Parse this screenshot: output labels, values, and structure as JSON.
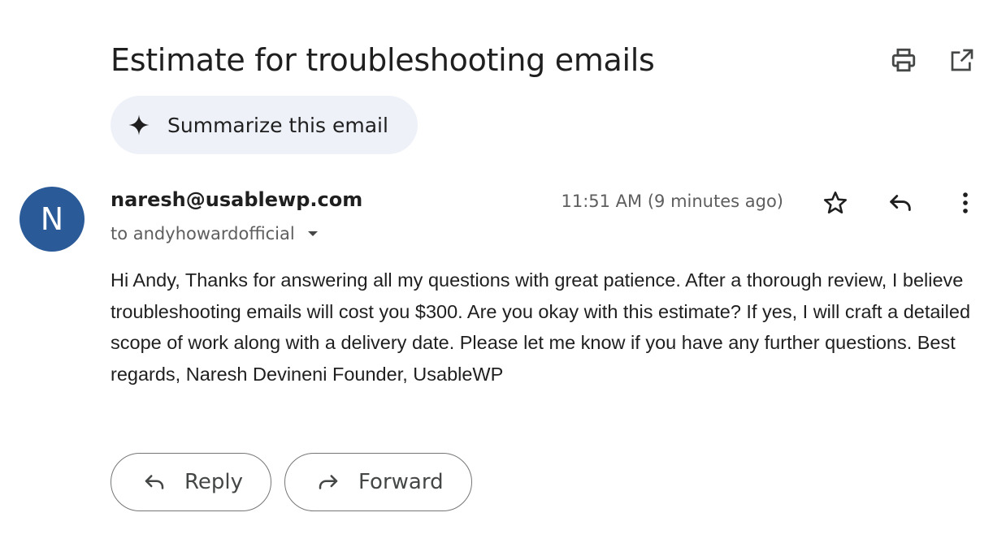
{
  "email": {
    "subject": "Estimate for troubleshooting emails",
    "summarize_label": "Summarize this email",
    "avatar_initial": "N",
    "sender": "naresh@usablewp.com",
    "recipients": "to andyhowardofficial",
    "timestamp": "11:51 AM (9 minutes ago)",
    "body": "Hi Andy, Thanks for answering all my questions with great patience. After a thorough review, I believe troubleshooting emails will cost you $300. Are you okay with this estimate? If yes, I will craft a detailed scope of work along with a delivery date. Please let me know if you have any further questions. Best regards, Naresh Devineni Founder, UsableWP"
  },
  "actions": {
    "reply_label": "Reply",
    "forward_label": "Forward"
  },
  "icons": {
    "top": [
      "print-icon",
      "open-in-new-window-icon"
    ],
    "message": [
      "star-icon",
      "reply-icon",
      "more-vert-icon"
    ]
  },
  "colors": {
    "avatar_bg": "#2a5a97",
    "summarize_bg": "#eef1f8"
  }
}
